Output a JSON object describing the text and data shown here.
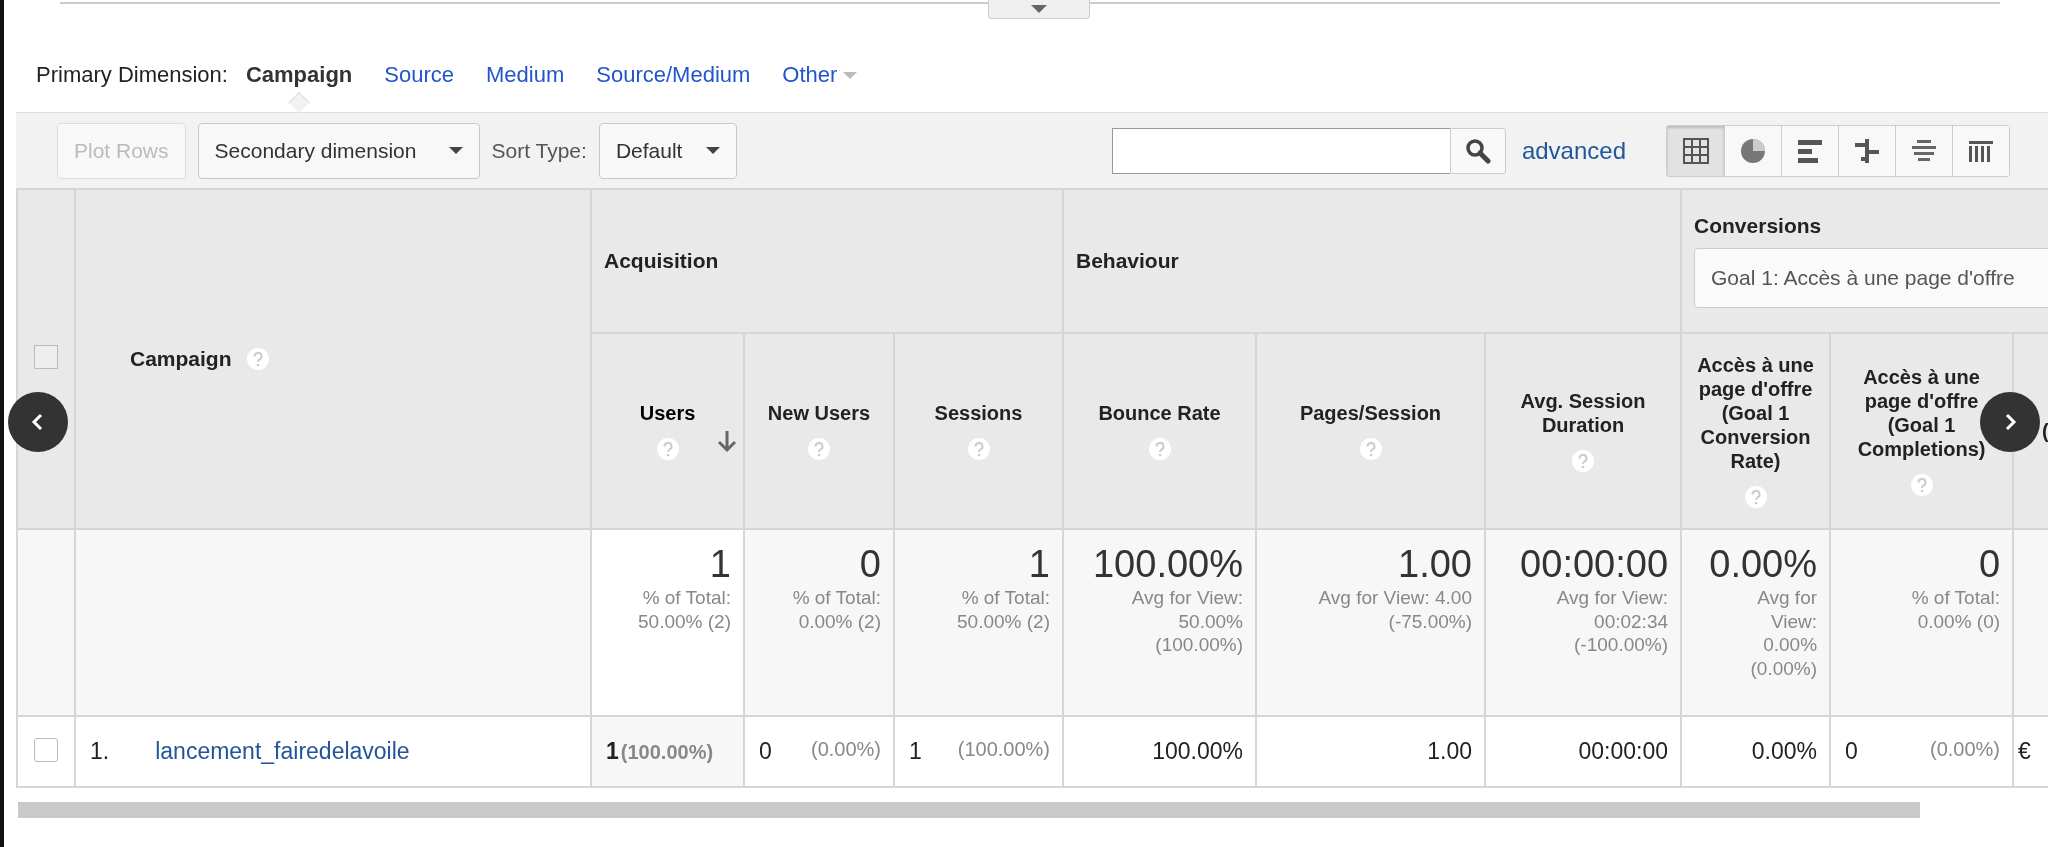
{
  "primary_dimension": {
    "label": "Primary Dimension:",
    "options": [
      {
        "label": "Campaign",
        "selected": true,
        "kind": "link"
      },
      {
        "label": "Source",
        "selected": false,
        "kind": "link"
      },
      {
        "label": "Medium",
        "selected": false,
        "kind": "link"
      },
      {
        "label": "Source/Medium",
        "selected": false,
        "kind": "link"
      },
      {
        "label": "Other",
        "selected": false,
        "kind": "dropdown"
      }
    ]
  },
  "toolbar": {
    "plot_rows": {
      "label": "Plot Rows",
      "disabled": true
    },
    "secondary_dimension": "Secondary dimension",
    "sort_label": "Sort Type:",
    "sort_value": "Default",
    "advanced": "advanced",
    "views": [
      {
        "kind": "table",
        "selected": true
      },
      {
        "kind": "pie",
        "selected": false
      },
      {
        "kind": "performance",
        "selected": false
      },
      {
        "kind": "comparison",
        "selected": false
      },
      {
        "kind": "term-cloud",
        "selected": false
      },
      {
        "kind": "pivot",
        "selected": false
      }
    ]
  },
  "table": {
    "select_all": {
      "checked": false
    },
    "dimension_header": "Campaign",
    "groups": [
      {
        "label": "Acquisition"
      },
      {
        "label": "Behaviour"
      },
      {
        "label": "Conversions",
        "goal": "Goal 1: Accès à une page d'offre"
      }
    ],
    "columns": [
      {
        "label": "Users",
        "sorted": true
      },
      {
        "label": "New Users",
        "sorted": false
      },
      {
        "label": "Sessions",
        "sorted": false
      },
      {
        "label": "Bounce Rate",
        "sorted": false
      },
      {
        "label": "Pages/Session",
        "sorted": false
      },
      {
        "label": "Avg. Session Duration",
        "sorted": false
      },
      {
        "label": "Accès à une page d'offre (Goal 1 Conversion Rate)",
        "sorted": false
      },
      {
        "label": "Accès à une page d'offre (Goal 1 Completions)",
        "sorted": false
      },
      {
        "label": "(",
        "sorted": false
      }
    ],
    "totals": [
      {
        "value": "1",
        "note": "% of Total:\n50.00% (2)"
      },
      {
        "value": "0",
        "note": "% of Total:\n0.00% (2)"
      },
      {
        "value": "1",
        "note": "% of Total:\n50.00% (2)"
      },
      {
        "value": "100.00%",
        "note": "Avg for View:\n50.00%\n(100.00%)"
      },
      {
        "value": "1.00",
        "note": "Avg for View: 4.00\n(-75.00%)"
      },
      {
        "value": "00:00:00",
        "note": "Avg for View:\n00:02:34\n(-100.00%)"
      },
      {
        "value": "0.00%",
        "note": "Avg for\nView:\n0.00%\n(0.00%)"
      },
      {
        "value": "0",
        "note": "% of Total:\n0.00% (0)"
      }
    ],
    "rows": [
      {
        "index": "1.",
        "campaign": "lancement_fairedelavoile",
        "checked": false,
        "cells": [
          {
            "value": "1",
            "share": "(100.00%)"
          },
          {
            "value": "0",
            "share": "(0.00%)"
          },
          {
            "value": "1",
            "share": "(100.00%)"
          },
          {
            "value": "100.00%"
          },
          {
            "value": "1.00"
          },
          {
            "value": "00:00:00"
          },
          {
            "value": "0.00%"
          },
          {
            "value": "0",
            "share": "(0.00%)"
          },
          {
            "value": "€"
          }
        ]
      }
    ]
  }
}
